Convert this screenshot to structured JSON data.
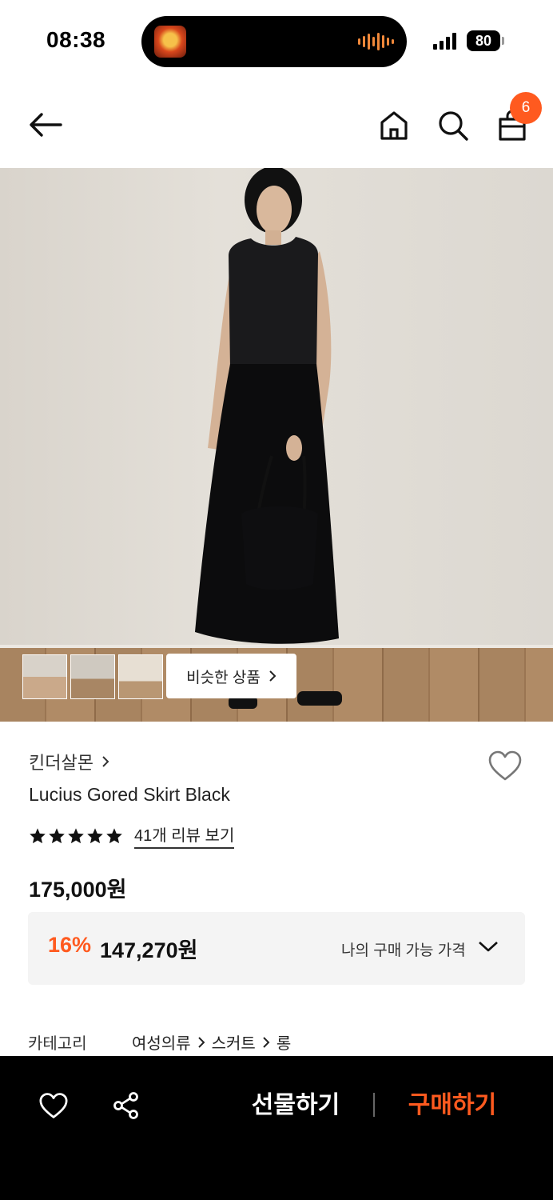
{
  "status_bar": {
    "time": "08:38",
    "battery": "80"
  },
  "header": {
    "cart_count": "6",
    "icons": [
      "back-arrow-icon",
      "home-icon",
      "search-icon",
      "shopping-bag-icon"
    ]
  },
  "hero": {
    "thumbnails": [
      "thumbnail-1",
      "thumbnail-2",
      "thumbnail-3"
    ],
    "similar_button": "비슷한 상품"
  },
  "product": {
    "brand": "킨더살몬",
    "name": "Lucius Gored Skirt Black",
    "rating_stars": 5,
    "review_link": "41개 리뷰 보기",
    "price": "175,000원",
    "discount_rate": "16%",
    "discount_price": "147,270원",
    "discount_label": "나의 구매 가능 가격"
  },
  "category": {
    "label": "카테고리",
    "path": [
      "여성의류",
      "스커트",
      "롱"
    ]
  },
  "bottom_bar": {
    "gift_label": "선물하기",
    "buy_label": "구매하기"
  },
  "colors": {
    "accent": "#ff5a1f",
    "bottom_bar_bg": "#000000",
    "discount_box_bg": "#f4f4f4"
  }
}
